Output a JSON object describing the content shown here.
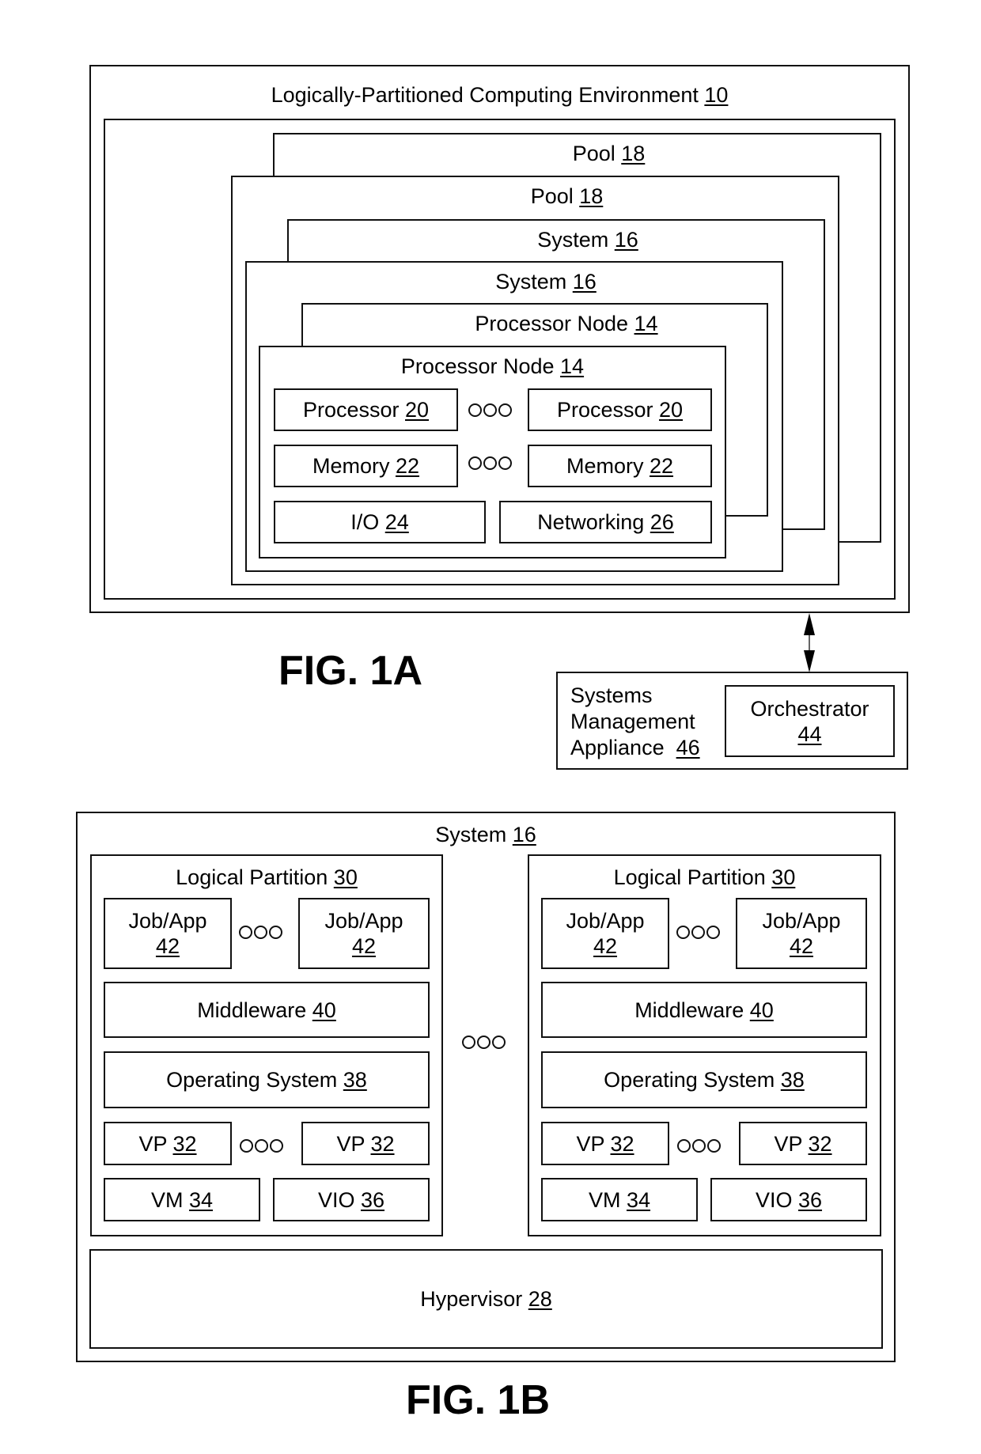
{
  "fig1a": {
    "caption": "FIG. 1A",
    "environment": {
      "label": "Logically-Partitioned Computing Environment",
      "ref": "10"
    },
    "pool_back": {
      "label": "Pool",
      "ref": "18"
    },
    "pool_front": {
      "label": "Pool",
      "ref": "18"
    },
    "system_back": {
      "label": "System",
      "ref": "16"
    },
    "system_front": {
      "label": "System",
      "ref": "16"
    },
    "node_back": {
      "label": "Processor Node",
      "ref": "14"
    },
    "node_front": {
      "label": "Processor Node",
      "ref": "14"
    },
    "processor_1": {
      "label": "Processor",
      "ref": "20"
    },
    "processor_2": {
      "label": "Processor",
      "ref": "20"
    },
    "memory_1": {
      "label": "Memory",
      "ref": "22"
    },
    "memory_2": {
      "label": "Memory",
      "ref": "22"
    },
    "io": {
      "label": "I/O",
      "ref": "24"
    },
    "networking": {
      "label": "Networking",
      "ref": "26"
    },
    "appliance": {
      "line1": "Systems",
      "line2": "Management",
      "line3": "Appliance",
      "ref": "46"
    },
    "orchestrator": {
      "label": "Orchestrator",
      "ref": "44"
    }
  },
  "fig1b": {
    "caption": "FIG. 1B",
    "system": {
      "label": "System",
      "ref": "16"
    },
    "partitions": [
      {
        "label": "Logical Partition",
        "ref": "30",
        "job_1": {
          "label": "Job/App",
          "ref": "42"
        },
        "job_2": {
          "label": "Job/App",
          "ref": "42"
        },
        "middleware": {
          "label": "Middleware",
          "ref": "40"
        },
        "os": {
          "label": "Operating System",
          "ref": "38"
        },
        "vp_1": {
          "label": "VP",
          "ref": "32"
        },
        "vp_2": {
          "label": "VP",
          "ref": "32"
        },
        "vm": {
          "label": "VM",
          "ref": "34"
        },
        "vio": {
          "label": "VIO",
          "ref": "36"
        }
      },
      {
        "label": "Logical Partition",
        "ref": "30",
        "job_1": {
          "label": "Job/App",
          "ref": "42"
        },
        "job_2": {
          "label": "Job/App",
          "ref": "42"
        },
        "middleware": {
          "label": "Middleware",
          "ref": "40"
        },
        "os": {
          "label": "Operating System",
          "ref": "38"
        },
        "vp_1": {
          "label": "VP",
          "ref": "32"
        },
        "vp_2": {
          "label": "VP",
          "ref": "32"
        },
        "vm": {
          "label": "VM",
          "ref": "34"
        },
        "vio": {
          "label": "VIO",
          "ref": "36"
        }
      }
    ],
    "hypervisor": {
      "label": "Hypervisor",
      "ref": "28"
    }
  }
}
